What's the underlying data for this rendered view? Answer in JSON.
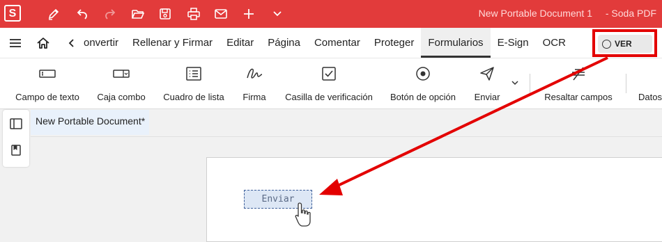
{
  "titlebar": {
    "logo": "S",
    "document_title": "New Portable Document 1",
    "app_title": "- Soda PDF",
    "quick_access": [
      "pen-icon",
      "undo-icon",
      "redo-icon",
      "folder-open-icon",
      "save-icon",
      "print-icon",
      "mail-icon",
      "plus-icon",
      "chevron-down-icon"
    ]
  },
  "menubar": {
    "tabs": [
      "onvertir",
      "Rellenar y Firmar",
      "Editar",
      "Página",
      "Comentar",
      "Proteger",
      "Formularios",
      "E-Sign",
      "OCR"
    ],
    "active_tab": "Formularios",
    "ver_label": "VER"
  },
  "toolbar": {
    "tools": [
      "Campo de texto",
      "Caja combo",
      "Cuadro de lista",
      "Firma",
      "Casilla de verificación",
      "Botón de opción",
      "Enviar",
      "Resaltar campos",
      "Datos"
    ]
  },
  "document": {
    "tab_label": "New Portable Document*",
    "field_text": "Enviar"
  },
  "colors": {
    "titlebar": "#e23b3b",
    "annotation": "#e30000"
  }
}
